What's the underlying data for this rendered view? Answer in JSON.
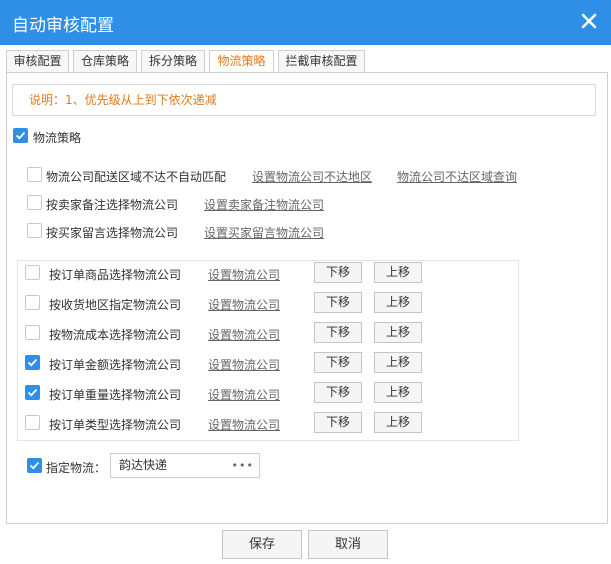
{
  "window": {
    "title": "自动审核配置"
  },
  "tabs": [
    "审核配置",
    "仓库策略",
    "拆分策略",
    "物流策略",
    "拦截审核配置"
  ],
  "note": "说明：1、优先级从上到下依次递减",
  "logistics_strategy": {
    "label": "物流策略",
    "checked": true
  },
  "options": [
    {
      "label": "物流公司配送区域不达不自动匹配",
      "checked": false,
      "links": [
        "设置物流公司不达地区",
        "物流公司不达区域查询"
      ]
    },
    {
      "label": "按卖家备注选择物流公司",
      "checked": false,
      "links": [
        "设置卖家备注物流公司"
      ]
    },
    {
      "label": "按买家留言选择物流公司",
      "checked": false,
      "links": [
        "设置买家留言物流公司"
      ]
    }
  ],
  "priority_rules": [
    {
      "label": "按订单商品选择物流公司",
      "checked": false,
      "link": "设置物流公司",
      "down": "下移",
      "up": "上移"
    },
    {
      "label": "按收货地区指定物流公司",
      "checked": false,
      "link": "设置物流公司",
      "down": "下移",
      "up": "上移"
    },
    {
      "label": "按物流成本选择物流公司",
      "checked": false,
      "link": "设置物流公司",
      "down": "下移",
      "up": "上移"
    },
    {
      "label": "按订单金额选择物流公司",
      "checked": true,
      "link": "设置物流公司",
      "down": "下移",
      "up": "上移"
    },
    {
      "label": "按订单重量选择物流公司",
      "checked": true,
      "link": "设置物流公司",
      "down": "下移",
      "up": "上移"
    },
    {
      "label": "按订单类型选择物流公司",
      "checked": false,
      "link": "设置物流公司",
      "down": "下移",
      "up": "上移"
    }
  ],
  "designated": {
    "label": "指定物流：",
    "checked": true,
    "value": "韵达快递",
    "more": "•••"
  },
  "footer": {
    "save": "保存",
    "cancel": "取消"
  },
  "colors": {
    "title_bar": "#2f8ee6",
    "accent": "#e07a1f",
    "checkbox_on": "#2f8ee6"
  },
  "icons": {
    "close": "close-icon",
    "check": "checkmark-icon",
    "more": "ellipsis-icon"
  }
}
